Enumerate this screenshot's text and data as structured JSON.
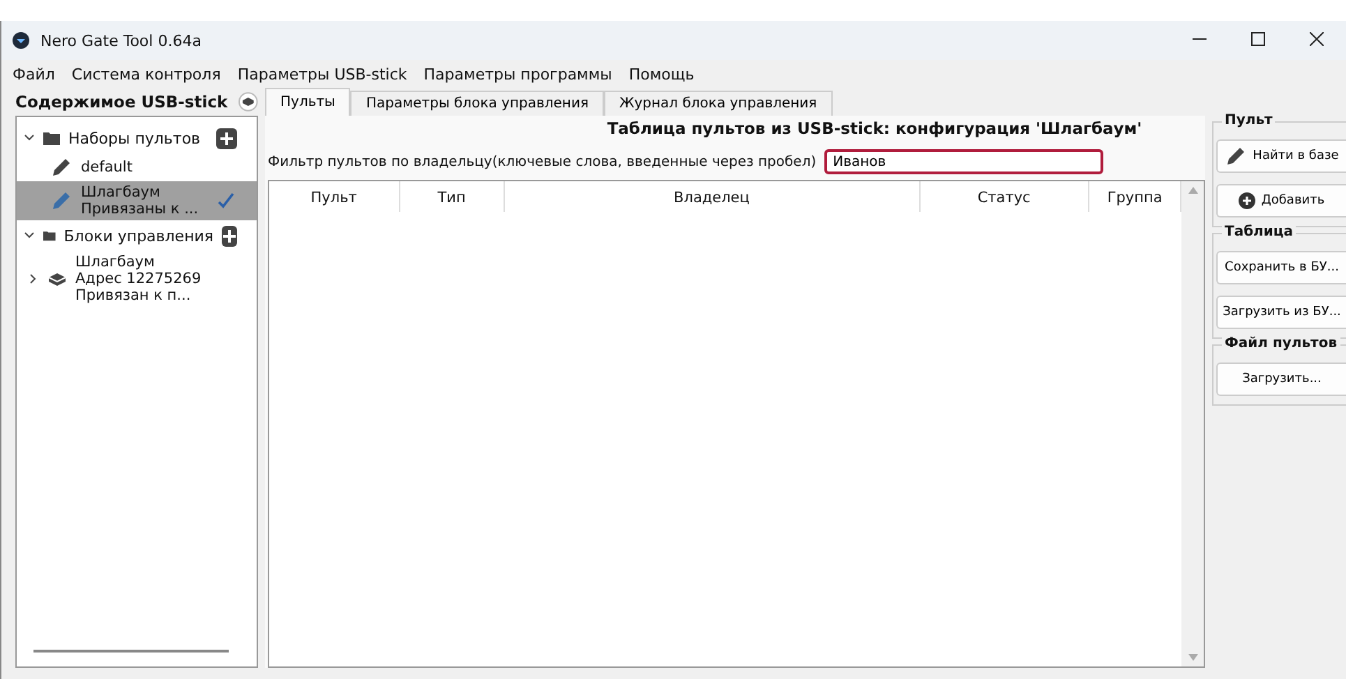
{
  "window": {
    "title": "Nero Gate Tool 0.64a"
  },
  "menu": [
    "Файл",
    "Система контроля",
    "Параметры USB-stick",
    "Параметры программы",
    "Помощь"
  ],
  "sidebar": {
    "title": "Содержимое USB-stick",
    "tree": [
      {
        "label": "Наборы пультов",
        "kind": "folder",
        "expanded": true,
        "children": [
          {
            "lines": [
              "default"
            ],
            "kind": "remotes",
            "selected": false,
            "active": false
          },
          {
            "lines": [
              "Шлагбаум",
              "Привязаны к ..."
            ],
            "kind": "remotes",
            "selected": true,
            "active": true
          }
        ]
      },
      {
        "label": "Блоки управления",
        "kind": "folder",
        "expanded": true,
        "children": [
          {
            "lines": [
              "Шлагбаум",
              "Адрес 12275269",
              "Привязан к п..."
            ],
            "kind": "unit",
            "expanded": false,
            "selected": false,
            "active": false
          }
        ]
      }
    ]
  },
  "tabs": [
    {
      "label": "Пульты",
      "selected": true
    },
    {
      "label": "Параметры блока управления",
      "selected": false
    },
    {
      "label": "Журнал блока управления",
      "selected": false
    }
  ],
  "heading": "Таблица пультов из USB-stick: конфигурация 'Шлагбаум'",
  "filter": {
    "label": "Фильтр пультов по владельцу(ключевые слова, введенные через пробел)",
    "value": "Иванов",
    "highlighted": true
  },
  "table": {
    "columns": [
      "Пульт",
      "Тип",
      "Владелец",
      "Статус",
      "Группа"
    ]
  },
  "groups": [
    {
      "title": "Пульт",
      "buttons": [
        {
          "label": "Найти в базе",
          "kind": "pencil"
        },
        {
          "label": "Добавить",
          "kind": "plus"
        }
      ]
    },
    {
      "title": "Таблица",
      "buttons": [
        {
          "label": "Сохранить в БУ...",
          "kind": "text"
        },
        {
          "label": "Загрузить из БУ...",
          "kind": "text"
        }
      ]
    },
    {
      "title": "Файл пультов",
      "buttons": [
        {
          "label": "Загрузить...",
          "kind": "text"
        }
      ]
    }
  ]
}
